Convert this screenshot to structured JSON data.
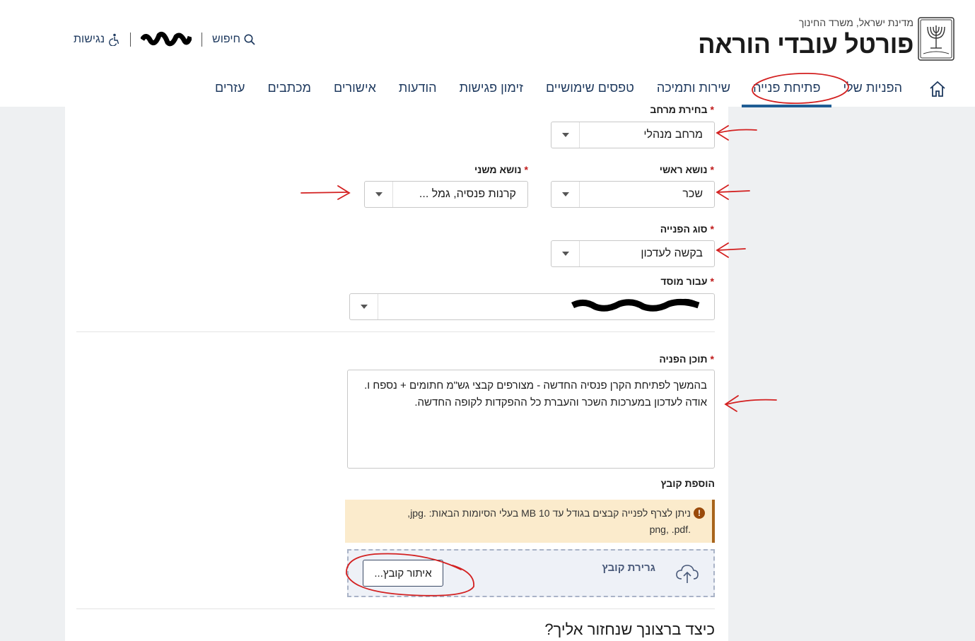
{
  "header": {
    "gov_line": "מדינת ישראל, משרד החינוך",
    "portal_title": "פורטל עובדי הוראה",
    "emblem_icon": "menorah-emblem-icon",
    "utilities": {
      "search_label": "חיפוש",
      "accessibility_label": "נגישות",
      "user_name_redacted": true
    }
  },
  "nav": {
    "items": [
      {
        "label": "הפניות שלי"
      },
      {
        "label": "פתיחת פנייה",
        "active": true
      },
      {
        "label": "שירות ותמיכה"
      },
      {
        "label": "טפסים שימושיים"
      },
      {
        "label": "זימון פגישות"
      },
      {
        "label": "הודעות"
      },
      {
        "label": "אישורים"
      },
      {
        "label": "מכתבים"
      },
      {
        "label": "עזרים"
      }
    ]
  },
  "form": {
    "required_mark": "*",
    "space": {
      "label": "בחירת מרחב",
      "value": "מרחב מנהלי"
    },
    "main_topic": {
      "label": "נושא ראשי",
      "value": "שכר"
    },
    "sub_topic": {
      "label": "נושא משני",
      "value": "קרנות פנסיה, גמל ..."
    },
    "request_type": {
      "label": "סוג הפנייה",
      "value": "בקשה לעדכון"
    },
    "institution": {
      "label": "עבור מוסד",
      "value_redacted": true
    },
    "content": {
      "label": "תוכן הפניה",
      "lines": [
        "בהמשך לפתיחת הקרן פנסיה החדשה - מצורפים קבצי גש\"מ חתומים + נספח ו.",
        "אודה לעדכון במערכות השכר והעברת כל ההפקדות לקופה החדשה."
      ]
    },
    "attachment": {
      "label": "הוספת קובץ",
      "notice_line1": "ניתן לצרף לפנייה קבצים בגודל עד 10 MB בעלי הסיומות הבאות: .jpg,",
      "notice_line2": ".png, .pdf",
      "drop_label": "גרירת קובץ",
      "browse_label": "איתור קובץ..."
    },
    "next_section_title": "כיצד ברצונך שנחזור אליך?"
  },
  "colors": {
    "accent": "#1f5d94",
    "nav_text": "#1f3a5f",
    "required": "#c01a1a",
    "annotation": "#d32020",
    "notice_bg": "#fbebcc",
    "page_bg": "#eef0f2"
  }
}
